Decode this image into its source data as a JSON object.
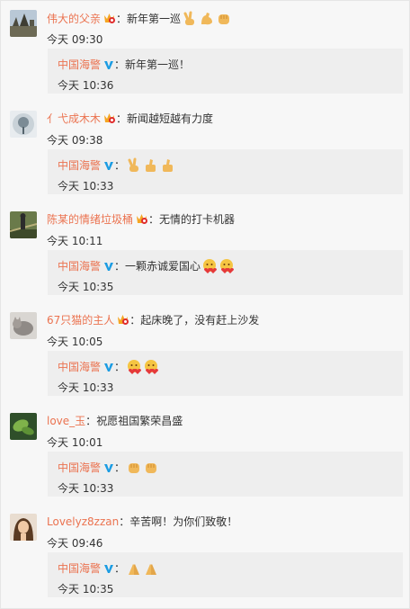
{
  "reply_user": "中国海警",
  "colon": "：",
  "comments": [
    {
      "user": "伟大的父亲",
      "text": "新年第一巡",
      "emojis": [
        "victory-hand-emoji",
        "flexed-bicep-emoji",
        "raised-fist-emoji"
      ],
      "time": "今天 09:30",
      "reply": {
        "text": "新年第一巡！",
        "emojis": [],
        "time": "今天 10:36"
      }
    },
    {
      "user": "亻弋成木木",
      "text": "新闻越短越有力度",
      "emojis": [],
      "time": "今天 09:38",
      "reply": {
        "text": "",
        "emojis": [
          "victory-hand-emoji",
          "thumbs-up-emoji",
          "thumbs-up-emoji"
        ],
        "time": "今天 10:33"
      }
    },
    {
      "user": "陈某的情绪垃圾桶",
      "text": "无情的打卡机器",
      "emojis": [],
      "time": "今天 10:11",
      "reply": {
        "text": "一颗赤诚爱国心",
        "emojis": [
          "heart-hug-face-emoji",
          "heart-hug-face-emoji"
        ],
        "time": "今天 10:35"
      }
    },
    {
      "user": "67只猫的主人",
      "text": "起床晚了，没有赶上沙发",
      "emojis": [],
      "time": "今天 10:05",
      "reply": {
        "text": "",
        "emojis": [
          "heart-hug-face-emoji",
          "heart-hug-face-emoji"
        ],
        "time": "今天 10:33"
      }
    },
    {
      "user": "love_玉",
      "text": "祝愿祖国繁荣昌盛",
      "emojis": [],
      "time": "今天 10:01",
      "reply": {
        "text": "",
        "emojis": [
          "raised-fist-emoji",
          "raised-fist-emoji"
        ],
        "time": "今天 10:33"
      }
    },
    {
      "user": "Lovelyz8zzan",
      "text": "辛苦啊！为你们致敬！",
      "emojis": [],
      "time": "今天 09:46",
      "reply": {
        "text": "",
        "emojis": [
          "clasped-hands-emoji",
          "clasped-hands-emoji"
        ],
        "time": "今天 10:35"
      }
    }
  ],
  "colors": {
    "username": "#eb7350",
    "reply_bg": "#eeeeee",
    "page_bg": "#f7f7f7",
    "verified": "#1b9ce3",
    "badge": "#f5a623"
  }
}
